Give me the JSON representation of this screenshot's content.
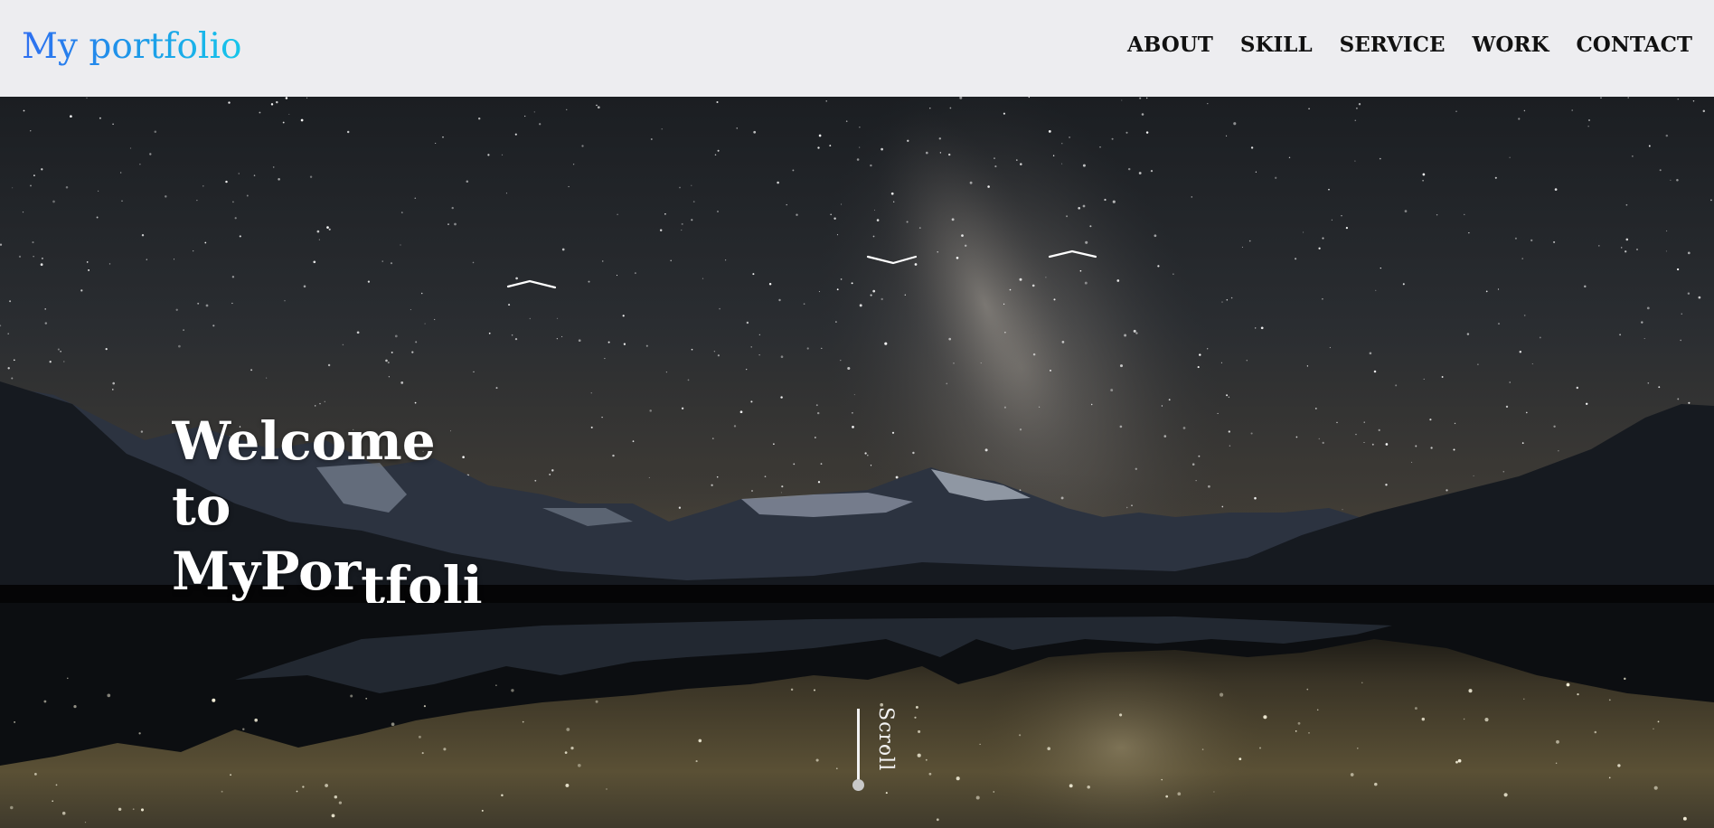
{
  "header": {
    "logo": "My portfolio",
    "nav": [
      "ABOUT",
      "SKILL",
      "SERVICE",
      "WORK",
      "CONTACT"
    ]
  },
  "hero": {
    "welcome_line1": "Welcome",
    "welcome_line2": "to",
    "welcome_line3a": "MyPor",
    "welcome_line3b": "tfoli",
    "scroll_label": "Scroll",
    "background_description_icon": "night-sky-mountain-lake"
  },
  "colors": {
    "header_bg": "#ededf0",
    "logo_gradient_start": "#2f6ff0",
    "logo_gradient_end": "#17c6ea",
    "nav_text": "#111111",
    "hero_text": "#ffffff"
  }
}
